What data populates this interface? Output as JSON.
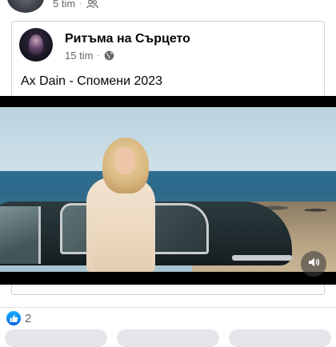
{
  "outer_post": {
    "time": "5 tim",
    "separator": "·",
    "audience_icon": "friends-icon"
  },
  "shared_post": {
    "page_name": "Ритъма на Сърцето",
    "time": "15 tim",
    "separator": "·",
    "audience_icon": "globe-icon",
    "text": "Ax Dain - Спомени 2023"
  },
  "video": {
    "mute_icon": "volume-icon"
  },
  "reactions": {
    "icon": "like-icon",
    "count": "2"
  },
  "colors": {
    "facebook_blue": "#0866ff",
    "secondary_text": "#65676b",
    "card_border": "#ced0d4"
  }
}
